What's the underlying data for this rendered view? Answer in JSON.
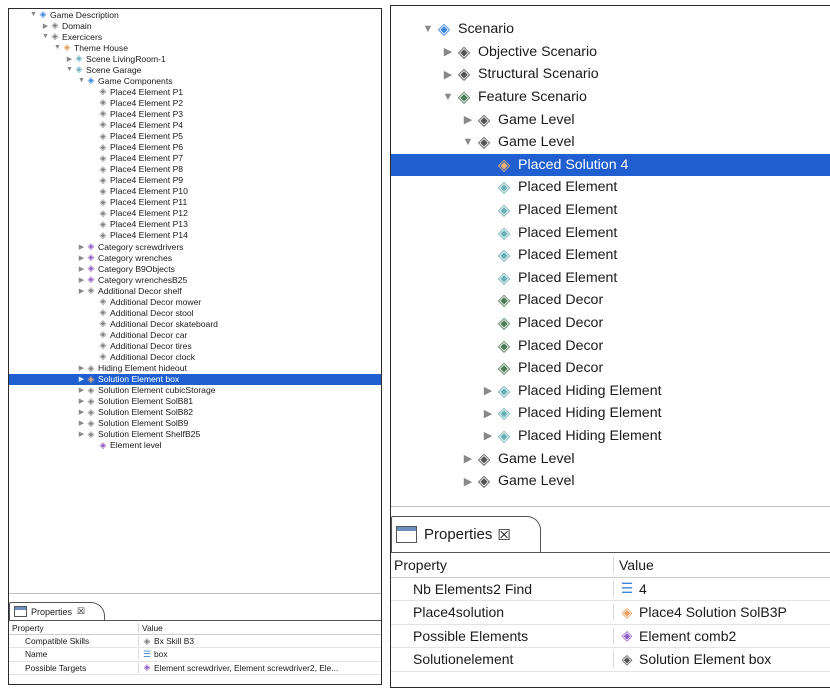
{
  "left": {
    "tree": [
      {
        "label": "Game Description",
        "depth": 0,
        "tw": "▼",
        "icon": "◈",
        "color": "blue"
      },
      {
        "label": "Domain",
        "depth": 1,
        "tw": "▶",
        "icon": "◈",
        "color": "gray"
      },
      {
        "label": "Exercicers",
        "depth": 1,
        "tw": "▼",
        "icon": "◈",
        "color": "gray"
      },
      {
        "label": "Theme House",
        "depth": 2,
        "tw": "▼",
        "icon": "◈",
        "color": "orange"
      },
      {
        "label": "Scene LivingRoom-1",
        "depth": 3,
        "tw": "▶",
        "icon": "◈",
        "color": "teal"
      },
      {
        "label": "Scene Garage",
        "depth": 3,
        "tw": "▼",
        "icon": "◈",
        "color": "teal"
      },
      {
        "label": "Game Components",
        "depth": 4,
        "tw": "▼",
        "icon": "◈",
        "color": "blue"
      },
      {
        "label": "Place4 Element P1",
        "depth": 5,
        "tw": "",
        "icon": "◈",
        "color": "gray"
      },
      {
        "label": "Place4 Element P2",
        "depth": 5,
        "tw": "",
        "icon": "◈",
        "color": "gray"
      },
      {
        "label": "Place4 Element P3",
        "depth": 5,
        "tw": "",
        "icon": "◈",
        "color": "gray"
      },
      {
        "label": "Place4 Element P4",
        "depth": 5,
        "tw": "",
        "icon": "◈",
        "color": "gray"
      },
      {
        "label": "Place4 Element P5",
        "depth": 5,
        "tw": "",
        "icon": "◈",
        "color": "gray"
      },
      {
        "label": "Place4 Element P6",
        "depth": 5,
        "tw": "",
        "icon": "◈",
        "color": "gray"
      },
      {
        "label": "Place4 Element P7",
        "depth": 5,
        "tw": "",
        "icon": "◈",
        "color": "gray"
      },
      {
        "label": "Place4 Element P8",
        "depth": 5,
        "tw": "",
        "icon": "◈",
        "color": "gray"
      },
      {
        "label": "Place4 Element P9",
        "depth": 5,
        "tw": "",
        "icon": "◈",
        "color": "gray"
      },
      {
        "label": "Place4 Element P10",
        "depth": 5,
        "tw": "",
        "icon": "◈",
        "color": "gray"
      },
      {
        "label": "Place4 Element P11",
        "depth": 5,
        "tw": "",
        "icon": "◈",
        "color": "gray"
      },
      {
        "label": "Place4 Element P12",
        "depth": 5,
        "tw": "",
        "icon": "◈",
        "color": "gray"
      },
      {
        "label": "Place4 Element P13",
        "depth": 5,
        "tw": "",
        "icon": "◈",
        "color": "gray"
      },
      {
        "label": "Place4 Element P14",
        "depth": 5,
        "tw": "",
        "icon": "◈",
        "color": "gray"
      },
      {
        "label": "Category screwdrivers",
        "depth": 4,
        "tw": "▶",
        "icon": "◈",
        "color": "purple"
      },
      {
        "label": "Category wrenches",
        "depth": 4,
        "tw": "▶",
        "icon": "◈",
        "color": "purple"
      },
      {
        "label": "Category B9Objects",
        "depth": 4,
        "tw": "▶",
        "icon": "◈",
        "color": "purple"
      },
      {
        "label": "Category wrenchesB25",
        "depth": 4,
        "tw": "▶",
        "icon": "◈",
        "color": "purple"
      },
      {
        "label": "Additional Decor shelf",
        "depth": 4,
        "tw": "▶",
        "icon": "◈",
        "color": "gray"
      },
      {
        "label": "Additional Decor mower",
        "depth": 5,
        "tw": "",
        "icon": "◈",
        "color": "gray"
      },
      {
        "label": "Additional Decor stool",
        "depth": 5,
        "tw": "",
        "icon": "◈",
        "color": "gray"
      },
      {
        "label": "Additional Decor skateboard",
        "depth": 5,
        "tw": "",
        "icon": "◈",
        "color": "gray"
      },
      {
        "label": "Additional Decor car",
        "depth": 5,
        "tw": "",
        "icon": "◈",
        "color": "gray"
      },
      {
        "label": "Additional Decor tires",
        "depth": 5,
        "tw": "",
        "icon": "◈",
        "color": "gray"
      },
      {
        "label": "Additional Decor clock",
        "depth": 5,
        "tw": "",
        "icon": "◈",
        "color": "gray"
      },
      {
        "label": "Hiding Element hideout",
        "depth": 4,
        "tw": "▶",
        "icon": "◈",
        "color": "gray"
      },
      {
        "label": "Solution Element box",
        "depth": 4,
        "tw": "▶",
        "icon": "◈",
        "color": "orange",
        "selected": true
      },
      {
        "label": "Solution Element cubicStorage",
        "depth": 4,
        "tw": "▶",
        "icon": "◈",
        "color": "gray"
      },
      {
        "label": "Solution Element SolB81",
        "depth": 4,
        "tw": "▶",
        "icon": "◈",
        "color": "gray"
      },
      {
        "label": "Solution Element SolB82",
        "depth": 4,
        "tw": "▶",
        "icon": "◈",
        "color": "gray"
      },
      {
        "label": "Solution Element SolB9",
        "depth": 4,
        "tw": "▶",
        "icon": "◈",
        "color": "gray"
      },
      {
        "label": "Solution Element ShelfB25",
        "depth": 4,
        "tw": "▶",
        "icon": "◈",
        "color": "gray"
      },
      {
        "label": "Element level",
        "depth": 5,
        "tw": "",
        "icon": "◈",
        "color": "purple"
      }
    ],
    "properties": {
      "tab_label": "Properties",
      "tab_close": "☒",
      "header": {
        "property": "Property",
        "value": "Value"
      },
      "rows": [
        {
          "property": "Compatible Skills",
          "icon": "◈",
          "color": "gray",
          "value": "Bx Skill B3"
        },
        {
          "property": "Name",
          "icon": "list",
          "color": "blue",
          "value": "box"
        },
        {
          "property": "Possible Targets",
          "icon": "◈",
          "color": "purple",
          "value": "Element screwdriver, Element screwdriver2, Ele..."
        }
      ]
    }
  },
  "right": {
    "tree": [
      {
        "label": "Scenario",
        "depth": 0,
        "tw": "▼",
        "icon": "◈",
        "color": "blue"
      },
      {
        "label": "Objective Scenario",
        "depth": 1,
        "tw": "▶",
        "icon": "◈",
        "color": "dark"
      },
      {
        "label": "Structural Scenario",
        "depth": 1,
        "tw": "▶",
        "icon": "◈",
        "color": "dark"
      },
      {
        "label": "Feature Scenario",
        "depth": 1,
        "tw": "▼",
        "icon": "◈",
        "color": "green"
      },
      {
        "label": "Game Level",
        "depth": 2,
        "tw": "▶",
        "icon": "◈",
        "color": "dark"
      },
      {
        "label": "Game Level",
        "depth": 2,
        "tw": "▼",
        "icon": "◈",
        "color": "dark"
      },
      {
        "label": "Placed Solution 4",
        "depth": 3,
        "tw": "",
        "icon": "◈",
        "color": "orange",
        "selected": true
      },
      {
        "label": "Placed Element",
        "depth": 3,
        "tw": "",
        "icon": "◈",
        "color": "teal"
      },
      {
        "label": "Placed Element",
        "depth": 3,
        "tw": "",
        "icon": "◈",
        "color": "teal"
      },
      {
        "label": "Placed Element",
        "depth": 3,
        "tw": "",
        "icon": "◈",
        "color": "teal"
      },
      {
        "label": "Placed Element",
        "depth": 3,
        "tw": "",
        "icon": "◈",
        "color": "teal"
      },
      {
        "label": "Placed Element",
        "depth": 3,
        "tw": "",
        "icon": "◈",
        "color": "teal"
      },
      {
        "label": "Placed Decor",
        "depth": 3,
        "tw": "",
        "icon": "◈",
        "color": "green"
      },
      {
        "label": "Placed Decor",
        "depth": 3,
        "tw": "",
        "icon": "◈",
        "color": "green"
      },
      {
        "label": "Placed Decor",
        "depth": 3,
        "tw": "",
        "icon": "◈",
        "color": "green"
      },
      {
        "label": "Placed Decor",
        "depth": 3,
        "tw": "",
        "icon": "◈",
        "color": "green"
      },
      {
        "label": "Placed Hiding Element",
        "depth": 3,
        "tw": "▶",
        "icon": "◈",
        "color": "teal"
      },
      {
        "label": "Placed Hiding Element",
        "depth": 3,
        "tw": "▶",
        "icon": "◈",
        "color": "teal"
      },
      {
        "label": "Placed Hiding Element",
        "depth": 3,
        "tw": "▶",
        "icon": "◈",
        "color": "teal"
      },
      {
        "label": "Game Level",
        "depth": 2,
        "tw": "▶",
        "icon": "◈",
        "color": "dark"
      },
      {
        "label": "Game Level",
        "depth": 2,
        "tw": "▶",
        "icon": "◈",
        "color": "dark"
      }
    ],
    "properties": {
      "tab_label": "Properties",
      "tab_close": "☒",
      "header": {
        "property": "Property",
        "value": "Value"
      },
      "rows": [
        {
          "property": "Nb Elements2 Find",
          "icon": "list",
          "color": "blue",
          "value": "4"
        },
        {
          "property": "Place4solution",
          "icon": "◈",
          "color": "orange",
          "value": "Place4 Solution SolB3P"
        },
        {
          "property": "Possible Elements",
          "icon": "◈",
          "color": "purple",
          "value": "Element comb2"
        },
        {
          "property": "Solutionelement",
          "icon": "◈",
          "color": "dark",
          "value": "Solution Element box"
        }
      ]
    }
  }
}
